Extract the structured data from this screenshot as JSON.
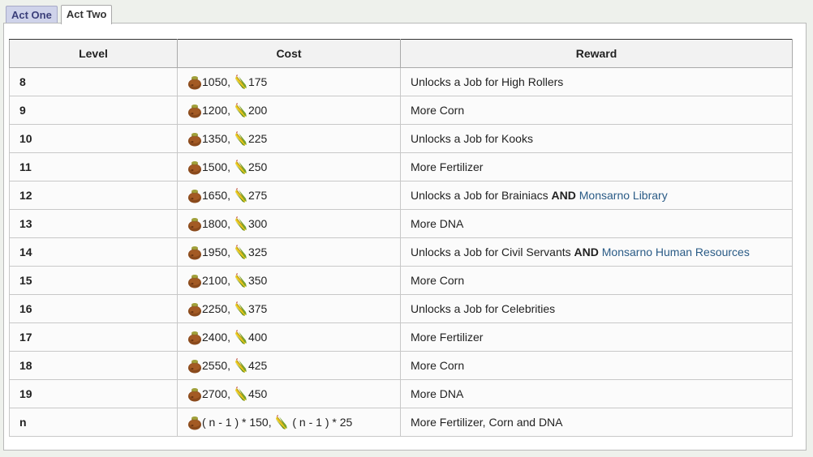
{
  "tabs": [
    {
      "label": "Act One",
      "active": false
    },
    {
      "label": "Act Two",
      "active": true
    }
  ],
  "table": {
    "headers": {
      "level": "Level",
      "cost": "Cost",
      "reward": "Reward"
    },
    "rows": [
      {
        "level": "8",
        "cost_a": "1050",
        "cost_b": "175",
        "reward": "Unlocks a Job for High Rollers"
      },
      {
        "level": "9",
        "cost_a": "1200",
        "cost_b": "200",
        "reward": "More Corn"
      },
      {
        "level": "10",
        "cost_a": "1350",
        "cost_b": "225",
        "reward": "Unlocks a Job for Kooks"
      },
      {
        "level": "11",
        "cost_a": "1500",
        "cost_b": "250",
        "reward": "More Fertilizer"
      },
      {
        "level": "12",
        "cost_a": "1650",
        "cost_b": "275",
        "reward": "Unlocks a Job for Brainiacs",
        "reward_and": "AND",
        "reward_link": "Monsarno Library"
      },
      {
        "level": "13",
        "cost_a": "1800",
        "cost_b": "300",
        "reward": "More DNA"
      },
      {
        "level": "14",
        "cost_a": "1950",
        "cost_b": "325",
        "reward": "Unlocks a Job for Civil Servants",
        "reward_and": "AND",
        "reward_link": "Monsarno Human Resources"
      },
      {
        "level": "15",
        "cost_a": "2100",
        "cost_b": "350",
        "reward": "More Corn"
      },
      {
        "level": "16",
        "cost_a": "2250",
        "cost_b": "375",
        "reward": "Unlocks a Job for Celebrities"
      },
      {
        "level": "17",
        "cost_a": "2400",
        "cost_b": "400",
        "reward": "More Fertilizer"
      },
      {
        "level": "18",
        "cost_a": "2550",
        "cost_b": "425",
        "reward": "More Corn"
      },
      {
        "level": "19",
        "cost_a": "2700",
        "cost_b": "450",
        "reward": "More DNA"
      },
      {
        "level": "n",
        "cost_a": "( n - 1 ) * 150",
        "cost_b": " ( n - 1 ) * 25",
        "reward": "More Fertilizer, Corn and DNA"
      }
    ]
  },
  "icons": {
    "cost_a": "fertilizer-sack-icon",
    "cost_b": "corn-icon"
  },
  "colors": {
    "link": "#2a5b86",
    "tab_inactive_bg": "#cfd3ea",
    "tab_inactive_text": "#3b3f7a"
  }
}
